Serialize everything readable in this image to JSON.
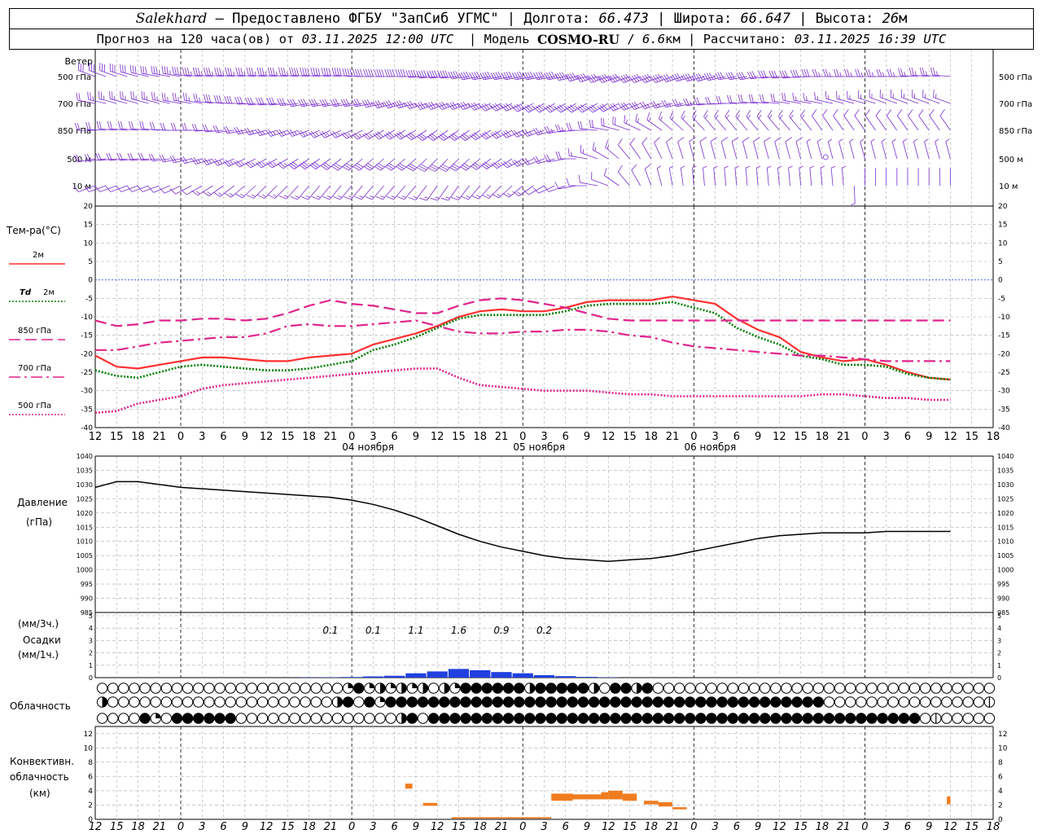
{
  "header": {
    "city": "Salekhard",
    "dash": "–",
    "provider": "Предоставлено ФГБУ \"ЗапСиб УГМС\"",
    "lon_label": "Долгота:",
    "lon": "66.473",
    "lat_label": "Широта:",
    "lat": "66.647",
    "alt_label": "Высота:",
    "alt": "26",
    "alt_unit": "м",
    "forecast_label": "Прогноз на 120 часа(ов) от",
    "forecast_start": "03.11.2025 12:00 UTC",
    "model_label": "Модель",
    "model": "COSMO-RU",
    "resolution": "6.6",
    "res_unit": "км",
    "calc_label": "Рассчитано:",
    "calc_time": "03.11.2025 16:39 UTC"
  },
  "chart_data": [
    {
      "type": "wind-barbs",
      "panel": "wind",
      "title": "Ветер",
      "levels": [
        "500 гПа",
        "700 гПа",
        "850 гПа",
        "500 м",
        "10 м"
      ],
      "color": "#7a2fd0",
      "x_hours": [
        0,
        3,
        6,
        9,
        12,
        15,
        18,
        21,
        24,
        27,
        30,
        33,
        36,
        39,
        42,
        45,
        48,
        51,
        54,
        57,
        60,
        63,
        66,
        69,
        72,
        75,
        78,
        81,
        84,
        87,
        90,
        93,
        96,
        99,
        102,
        105,
        108,
        111,
        114,
        117,
        120
      ],
      "direction_deg": {
        "500 гПа": [
          290,
          290,
          285,
          280,
          280,
          275,
          275,
          275,
          275,
          275,
          275,
          275,
          275,
          270,
          270,
          270,
          265,
          265,
          260,
          260,
          260,
          260,
          260,
          255,
          250,
          250,
          250,
          250,
          255,
          255,
          260,
          260,
          265,
          265,
          270,
          270,
          270,
          270,
          270,
          275,
          275
        ],
        "700 гПа": [
          280,
          285,
          285,
          285,
          280,
          280,
          275,
          270,
          265,
          265,
          260,
          260,
          260,
          260,
          255,
          255,
          250,
          250,
          250,
          245,
          245,
          240,
          240,
          240,
          240,
          245,
          250,
          255,
          260,
          265,
          270,
          275,
          275,
          280,
          280,
          285,
          285,
          290,
          290,
          290,
          290
        ],
        "850 гПа": [
          270,
          275,
          275,
          275,
          270,
          270,
          265,
          260,
          255,
          250,
          250,
          245,
          245,
          240,
          240,
          240,
          235,
          235,
          235,
          240,
          245,
          250,
          260,
          270,
          280,
          290,
          300,
          310,
          315,
          320,
          320,
          320,
          320,
          320,
          325,
          325,
          325,
          325,
          325,
          325,
          325
        ],
        "500 м": [
          260,
          265,
          265,
          265,
          260,
          255,
          250,
          245,
          240,
          240,
          235,
          235,
          230,
          230,
          230,
          230,
          225,
          225,
          230,
          235,
          240,
          250,
          260,
          280,
          300,
          320,
          330,
          340,
          345,
          345,
          345,
          345,
          345,
          345,
          345,
          345,
          345,
          345,
          345,
          345,
          345
        ],
        "10 м": [
          250,
          250,
          250,
          250,
          245,
          240,
          235,
          230,
          225,
          225,
          220,
          220,
          220,
          220,
          220,
          220,
          215,
          215,
          220,
          225,
          230,
          240,
          250,
          270,
          290,
          320,
          340,
          350,
          355,
          355,
          355,
          355,
          355,
          355,
          355,
          355,
          0,
          0,
          0,
          0,
          0
        ]
      },
      "speed_ms": {
        "500 гПа": [
          14,
          15,
          16,
          16,
          17,
          17,
          18,
          18,
          18,
          18,
          19,
          19,
          20,
          20,
          21,
          21,
          22,
          22,
          22,
          23,
          23,
          23,
          23,
          23,
          22,
          21,
          20,
          19,
          18,
          17,
          16,
          16,
          15,
          14,
          14,
          13,
          13,
          12,
          12,
          12,
          12
        ],
        "700 гПа": [
          11,
          12,
          12,
          13,
          13,
          13,
          14,
          14,
          14,
          15,
          15,
          15,
          16,
          16,
          17,
          17,
          17,
          17,
          18,
          18,
          18,
          18,
          17,
          17,
          16,
          15,
          14,
          13,
          12,
          11,
          10,
          10,
          9,
          9,
          8,
          8,
          8,
          8,
          8,
          8,
          8
        ],
        "850 гПа": [
          9,
          10,
          10,
          10,
          10,
          11,
          11,
          11,
          12,
          12,
          13,
          13,
          13,
          13,
          14,
          14,
          15,
          15,
          15,
          15,
          14,
          13,
          12,
          11,
          10,
          9,
          8,
          8,
          7,
          7,
          7,
          7,
          7,
          7,
          6,
          6,
          6,
          6,
          6,
          6,
          6
        ],
        "500 м": [
          9,
          10,
          10,
          11,
          11,
          11,
          12,
          12,
          13,
          13,
          14,
          14,
          14,
          15,
          15,
          15,
          16,
          16,
          15,
          14,
          13,
          11,
          10,
          8,
          7,
          6,
          6,
          5,
          5,
          5,
          4,
          4,
          4,
          4,
          3,
          3,
          3,
          3,
          3,
          3,
          3
        ],
        "10 м": [
          5,
          6,
          6,
          6,
          6,
          6,
          7,
          7,
          7,
          7,
          8,
          8,
          8,
          8,
          8,
          8,
          8,
          8,
          8,
          7,
          7,
          6,
          5,
          5,
          4,
          4,
          4,
          3,
          3,
          3,
          3,
          3,
          2,
          2,
          2,
          2,
          1,
          1,
          1,
          1,
          1
        ]
      }
    },
    {
      "type": "line",
      "panel": "temperature",
      "title": "Тем-ра(°С)",
      "ylim": [
        -40,
        20
      ],
      "x_hours": [
        0,
        3,
        6,
        9,
        12,
        15,
        18,
        21,
        24,
        27,
        30,
        33,
        36,
        39,
        42,
        45,
        48,
        51,
        54,
        57,
        60,
        63,
        66,
        69,
        72,
        75,
        78,
        81,
        84,
        87,
        90,
        93,
        96,
        99,
        102,
        105,
        108,
        111,
        114,
        117,
        120
      ],
      "series": [
        {
          "name": "2м",
          "color": "#ff3030",
          "style": "solid",
          "values": [
            -20.5,
            -23.5,
            -24,
            -23,
            -22,
            -21,
            -21,
            -21.5,
            -22,
            -22,
            -21,
            -20.5,
            -20,
            -17.5,
            -16,
            -14.5,
            -12.5,
            -10,
            -8.5,
            -8,
            -8.5,
            -8.5,
            -7.5,
            -6,
            -5.5,
            -5.5,
            -5.5,
            -4.5,
            -5.5,
            -6.5,
            -10.5,
            -13.5,
            -15.5,
            -19.5,
            -21,
            -22,
            -21.5,
            -23,
            -25,
            -26.5,
            -27
          ]
        },
        {
          "name": "Td 2м",
          "color": "#008000",
          "style": "dotted",
          "values": [
            -24.5,
            -26,
            -26.5,
            -25,
            -23.5,
            -23,
            -23.5,
            -24,
            -24.5,
            -24.5,
            -24,
            -23,
            -22,
            -19,
            -17.5,
            -15.5,
            -13,
            -10.5,
            -9.5,
            -9.5,
            -9.5,
            -9.5,
            -8.5,
            -7,
            -6.5,
            -6.5,
            -6.5,
            -6,
            -7.5,
            -9,
            -13,
            -15.5,
            -17.5,
            -20.5,
            -21.5,
            -23,
            -23,
            -23.5,
            -25.5,
            -26.5,
            -27
          ]
        },
        {
          "name": "850 гПа",
          "color": "#e0248c",
          "style": "longdash",
          "values": [
            -11,
            -12.5,
            -12,
            -11,
            -11,
            -10.5,
            -10.5,
            -11,
            -10.5,
            -9,
            -7,
            -5.5,
            -6.5,
            -7,
            -8,
            -9,
            -9,
            -7,
            -5.5,
            -5,
            -5.5,
            -6.5,
            -7.5,
            -9,
            -10.5,
            -11,
            -11,
            -11,
            -11,
            -11,
            -11,
            -11,
            -11,
            -11,
            -11,
            -11,
            -11,
            -11,
            -11,
            -11,
            -11
          ]
        },
        {
          "name": "700 гПа",
          "color": "#e0248c",
          "style": "dashdot",
          "values": [
            -19,
            -19,
            -18,
            -17,
            -16.5,
            -16,
            -15.5,
            -15.5,
            -14.5,
            -12.5,
            -12,
            -12.5,
            -12.5,
            -12,
            -11.5,
            -11,
            -12.5,
            -14,
            -14.5,
            -14.5,
            -14,
            -14,
            -13.5,
            -13.5,
            -14,
            -15,
            -15.5,
            -17,
            -18,
            -18.5,
            -19,
            -19.5,
            -20,
            -20.5,
            -20.5,
            -21,
            -21.5,
            -22,
            -22,
            -22,
            -22
          ]
        },
        {
          "name": "500 гПа",
          "color": "#e0248c",
          "style": "dotted",
          "values": [
            -36,
            -35.5,
            -33.5,
            -32.5,
            -31.5,
            -29.5,
            -28.5,
            -28,
            -27.5,
            -27,
            -26.5,
            -26,
            -25.5,
            -25,
            -24.5,
            -24,
            -24,
            -26.5,
            -28.5,
            -29,
            -29.5,
            -30,
            -30,
            -30,
            -30.5,
            -31,
            -31,
            -31.5,
            -31.5,
            -31.5,
            -31.5,
            -31.5,
            -31.5,
            -31.5,
            -31,
            -31,
            -31.5,
            -32,
            -32,
            -32.5,
            -32.5
          ]
        }
      ]
    },
    {
      "type": "line",
      "panel": "pressure",
      "title": "Давление",
      "unit": "(гПа)",
      "ylim": [
        985,
        1040
      ],
      "x_hours": [
        0,
        3,
        6,
        9,
        12,
        15,
        18,
        21,
        24,
        27,
        30,
        33,
        36,
        39,
        42,
        45,
        48,
        51,
        54,
        57,
        60,
        63,
        66,
        69,
        72,
        75,
        78,
        81,
        84,
        87,
        90,
        93,
        96,
        99,
        102,
        105,
        108,
        111,
        114,
        117,
        120
      ],
      "values": [
        1029,
        1031,
        1031,
        1030,
        1029,
        1028.5,
        1028,
        1027.5,
        1027,
        1026.5,
        1026,
        1025.5,
        1024.5,
        1023,
        1021,
        1018.5,
        1015.5,
        1012.5,
        1010,
        1008,
        1006.5,
        1005,
        1004,
        1003.5,
        1003,
        1003.5,
        1004,
        1005,
        1006.5,
        1008,
        1009.5,
        1011,
        1012,
        1012.5,
        1013,
        1013,
        1013,
        1013.5,
        1013.5,
        1013.5,
        1013.5
      ],
      "color": "#000000"
    },
    {
      "type": "bar",
      "panel": "precipitation",
      "title": "Осадки",
      "unit_left": "(мм/3ч.)",
      "unit_right": "(мм/1ч.)",
      "ylim": [
        0,
        5
      ],
      "color": "#2040e0",
      "x_hours": [
        30,
        33,
        36,
        39,
        42,
        45,
        48,
        51,
        54,
        57,
        60,
        63,
        66,
        69,
        72
      ],
      "values": [
        0.02,
        0.03,
        0.05,
        0.1,
        0.15,
        0.35,
        0.5,
        0.7,
        0.6,
        0.45,
        0.35,
        0.2,
        0.12,
        0.06,
        0.03
      ],
      "totals": [
        {
          "hour": 33,
          "value": "0.1"
        },
        {
          "hour": 39,
          "value": "0.1"
        },
        {
          "hour": 45,
          "value": "1.1"
        },
        {
          "hour": 51,
          "value": "1.6"
        },
        {
          "hour": 57,
          "value": "0.9"
        },
        {
          "hour": 63,
          "value": "0.2"
        }
      ]
    },
    {
      "type": "symbols",
      "panel": "cloudiness",
      "title": "Облачность",
      "rows": [
        "000000000000000000000002423232303244444434444430443400000000000000000000000000000000",
        "3000000000000000000000340424444444444444444444444444444444444444444400000000000000013",
        "0000420444444000000000000000340444444444444444444444444444444444444444444444401000000004444"
      ]
    },
    {
      "type": "bar",
      "panel": "convective",
      "title": "Конвективн. облачность",
      "unit": "(км)",
      "ylim": [
        0,
        13
      ],
      "color": "#f07c20",
      "segments": [
        {
          "start": 43.5,
          "end": 44.5,
          "base": 4.3,
          "top": 5
        },
        {
          "start": 46,
          "end": 48,
          "base": 1.9,
          "top": 2.3
        },
        {
          "start": 50,
          "end": 61,
          "base": 0.1,
          "top": 0.3
        },
        {
          "start": 61,
          "end": 64,
          "base": 0.1,
          "top": 0.3
        },
        {
          "start": 64,
          "end": 67,
          "base": 2.6,
          "top": 3.6
        },
        {
          "start": 67,
          "end": 71,
          "base": 2.8,
          "top": 3.5
        },
        {
          "start": 71,
          "end": 72,
          "base": 2.8,
          "top": 3.8
        },
        {
          "start": 72,
          "end": 74,
          "base": 2.8,
          "top": 4
        },
        {
          "start": 74,
          "end": 76,
          "base": 2.6,
          "top": 3.6
        },
        {
          "start": 77,
          "end": 79,
          "base": 2.1,
          "top": 2.6
        },
        {
          "start": 79,
          "end": 81,
          "base": 1.8,
          "top": 2.4
        },
        {
          "start": 81,
          "end": 83,
          "base": 1.4,
          "top": 1.7
        },
        {
          "start": 119.5,
          "end": 120,
          "base": 2.1,
          "top": 3.2
        }
      ]
    }
  ],
  "axis": {
    "hour_labels": [
      "12",
      "15",
      "18",
      "21",
      "0",
      "3",
      "6",
      "9",
      "12",
      "15",
      "18",
      "21",
      "0",
      "3",
      "6",
      "9",
      "12",
      "15",
      "18",
      "21",
      "0",
      "3",
      "6",
      "9",
      "12",
      "15",
      "18",
      "21",
      "0",
      "3",
      "6",
      "9",
      "12",
      "15",
      "18",
      "21",
      "0",
      "3",
      "6",
      "9",
      "12",
      "15",
      "18"
    ],
    "dates": [
      "04 ноября",
      "05 ноября",
      "06 ноября"
    ],
    "temp_ticks": [
      "20",
      "15",
      "10",
      "5",
      "0",
      "-5",
      "-10",
      "-15",
      "-20",
      "-25",
      "-30",
      "-35",
      "-40"
    ],
    "pres_ticks": [
      "1040",
      "1035",
      "1030",
      "1025",
      "1020",
      "1015",
      "1010",
      "1005",
      "1000",
      "995",
      "990",
      "985"
    ],
    "precip_ticks": [
      "5",
      "4",
      "3",
      "2",
      "1",
      "0"
    ],
    "conv_ticks": [
      "12",
      "10",
      "8",
      "6",
      "4",
      "2",
      "0"
    ]
  }
}
